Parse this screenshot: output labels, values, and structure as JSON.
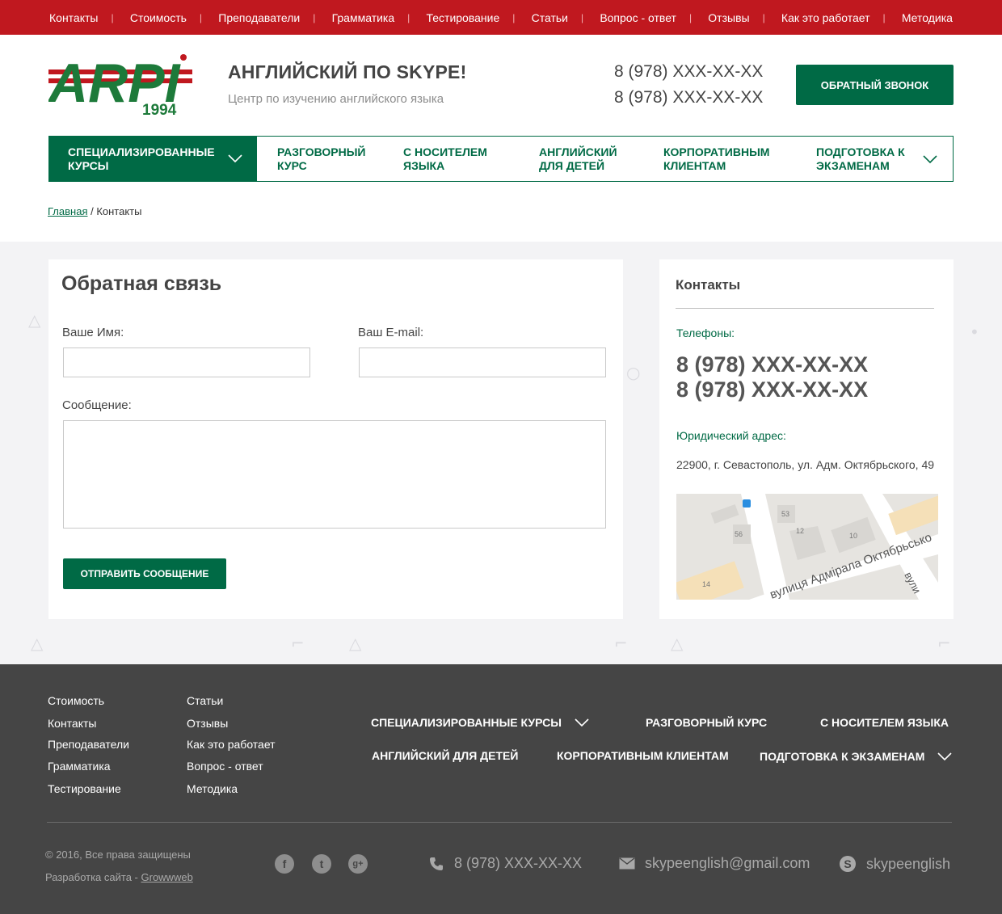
{
  "topnav": [
    "Контакты",
    "Стоимость",
    "Преподаватели",
    "Грамматика",
    "Тестирование",
    "Статьи",
    "Вопрос - ответ",
    "Отзывы",
    "Как это работает",
    "Методика"
  ],
  "logo": {
    "text": "ARPI",
    "year": "1994"
  },
  "header": {
    "title": "АНГЛИЙСКИЙ ПО SKYPE!",
    "subtitle": "Центр по изучению английского языка",
    "phones": [
      "8 (978) XXX-XX-XX",
      "8 (978) XXX-XX-XX"
    ],
    "callback_label": "ОБРАТНЫЙ ЗВОНОК"
  },
  "mainnav": [
    {
      "label": "СПЕЦИАЛИЗИРОВАННЫЕ КУРСЫ",
      "dropdown": true,
      "active": true
    },
    {
      "label": "РАЗГОВОРНЫЙ КУРС",
      "dropdown": false
    },
    {
      "label": "С НОСИТЕЛЕМ ЯЗЫКА",
      "dropdown": false
    },
    {
      "label": "АНГЛИЙСКИЙ ДЛЯ ДЕТЕЙ",
      "dropdown": false
    },
    {
      "label": "КОРПОРАТИВНЫМ КЛИЕНТАМ",
      "dropdown": false
    },
    {
      "label": "ПОДГОТОВКА К ЭКЗАМЕНАМ",
      "dropdown": true
    }
  ],
  "breadcrumb": {
    "home": "Главная",
    "sep": " / ",
    "current": "Контакты"
  },
  "form": {
    "title": "Обратная связь",
    "name_label": "Ваше Имя:",
    "email_label": "Ваш E-mail:",
    "message_label": "Сообщение:",
    "name_value": "",
    "email_value": "",
    "message_value": "",
    "submit_label": "ОТПРАВИТЬ СООБЩЕНИЕ"
  },
  "contacts": {
    "title": "Контакты",
    "phones_label": "Телефоны:",
    "phones": [
      "8 (978) XXX-XX-XX",
      "8 (978) XXX-XX-XX"
    ],
    "address_label": "Юридический адрес:",
    "address": "22900, г. Севастополь, ул. Адм. Октябрьского, 49",
    "map": {
      "street": "вулиця Адмірала Октябрьсько",
      "street2": "вули",
      "numbers": [
        "53",
        "56",
        "12",
        "10",
        "14"
      ]
    }
  },
  "footer": {
    "links_col1": [
      "Стоимость",
      "Контакты",
      "Преподаватели",
      "Грамматика",
      "Тестирование"
    ],
    "links_col2": [
      "Статьи",
      "Отзывы",
      "Как это работает",
      "Вопрос - ответ",
      "Методика"
    ],
    "nav": [
      {
        "label": "СПЕЦИАЛИЗИРОВАННЫЕ КУРСЫ",
        "dropdown": true
      },
      {
        "label": "РАЗГОВОРНЫЙ КУРС",
        "dropdown": false
      },
      {
        "label": "С НОСИТЕЛЕМ ЯЗЫКА",
        "dropdown": false
      },
      {
        "label": "АНГЛИЙСКИЙ ДЛЯ ДЕТЕЙ",
        "dropdown": false
      },
      {
        "label": "КОРПОРАТИВНЫМ КЛИЕНТАМ",
        "dropdown": false
      },
      {
        "label": "ПОДГОТОВКА К ЭКЗАМЕНАМ",
        "dropdown": true
      }
    ],
    "copyright": "© 2016, Все права защищены",
    "dev_prefix": "Разработка сайта - ",
    "dev_link": "Growwweb",
    "social": [
      {
        "icon": "facebook-icon",
        "glyph": "f"
      },
      {
        "icon": "tumblr-icon",
        "glyph": "t"
      },
      {
        "icon": "google-plus-icon",
        "glyph": "g+"
      }
    ],
    "phone": "8 (978) XXX-XX-XX",
    "email": "skypeenglish@gmail.com",
    "skype": "skypeenglish"
  },
  "colors": {
    "red": "#c0181f",
    "green": "#006a45",
    "footer_bg": "#454545",
    "content_bg": "#f3f3f5"
  }
}
